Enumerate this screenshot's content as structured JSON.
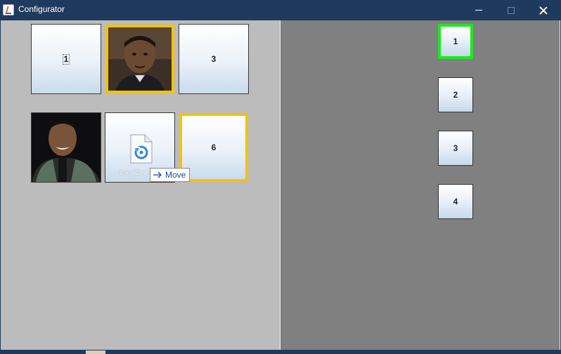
{
  "window": {
    "title": "Configurator",
    "icon": "java-cup-icon"
  },
  "left_panel": {
    "tiles": [
      {
        "label": "1",
        "kind": "button",
        "focused": true
      },
      {
        "label": "",
        "kind": "photo",
        "selected": true
      },
      {
        "label": "3",
        "kind": "button"
      },
      {
        "label": "",
        "kind": "photo"
      },
      {
        "label": "text (2).t",
        "kind": "file",
        "icon": "file-sync-icon"
      },
      {
        "label": "6",
        "kind": "button",
        "selected": true
      }
    ],
    "drag_tooltip": {
      "icon": "arrow-right-icon",
      "label": "Move"
    }
  },
  "right_panel": {
    "buttons": [
      {
        "label": "1",
        "active": true
      },
      {
        "label": "2"
      },
      {
        "label": "3"
      },
      {
        "label": "4"
      }
    ]
  },
  "colors": {
    "titlebar": "#1f3a5c",
    "left_panel": "#bcbcbc",
    "right_panel": "#808080",
    "selection_border": "#f7c200",
    "active_border": "#1ee81e",
    "tooltip_text": "#1a47a8"
  }
}
